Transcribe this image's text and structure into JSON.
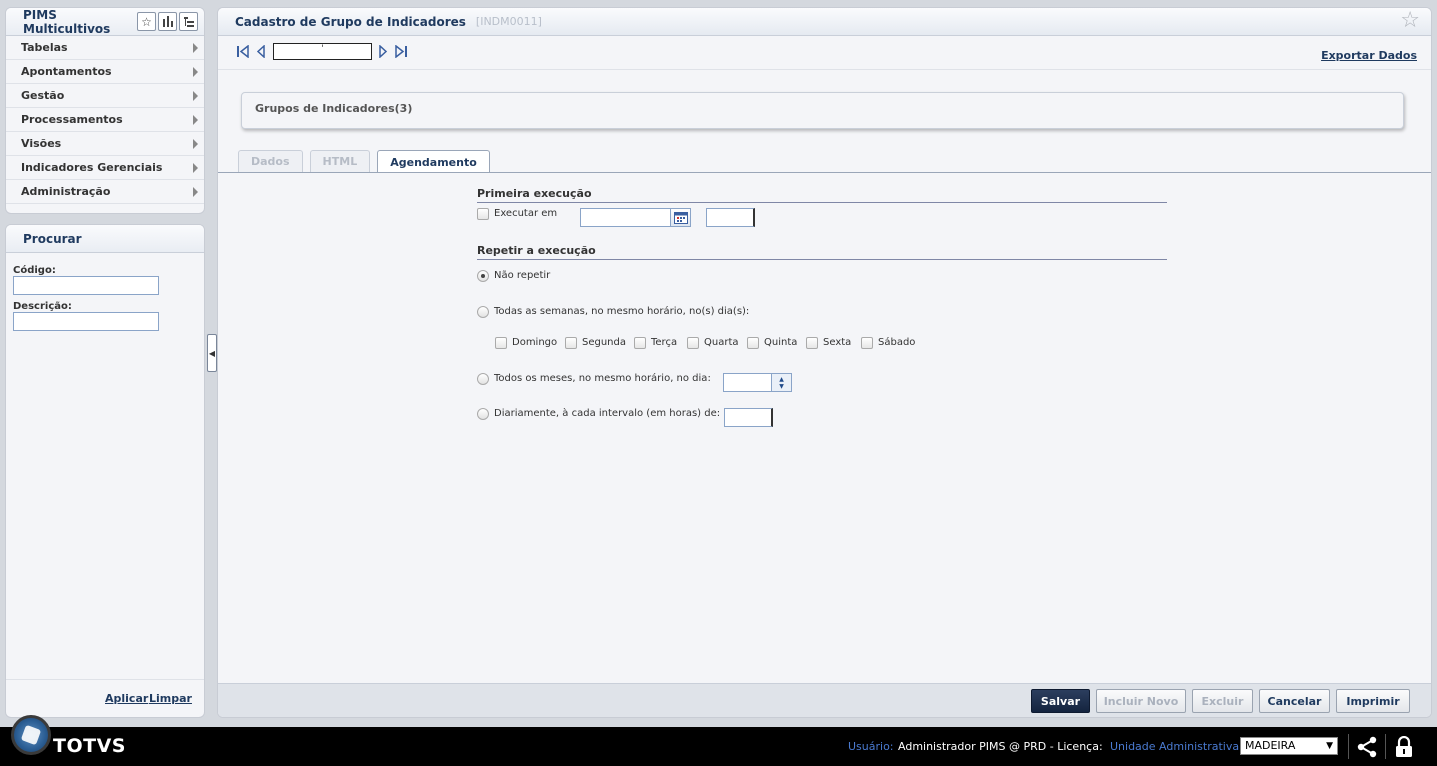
{
  "sidebar": {
    "title": "PIMS Multicultivos",
    "items": [
      {
        "label": "Tabelas"
      },
      {
        "label": "Apontamentos"
      },
      {
        "label": "Gestão"
      },
      {
        "label": "Processamentos"
      },
      {
        "label": "Visões"
      },
      {
        "label": "Indicadores Gerenciais"
      },
      {
        "label": "Administração"
      }
    ]
  },
  "search": {
    "title": "Procurar",
    "codigo_label": "Código:",
    "codigo_value": "",
    "descricao_label": "Descrição:",
    "descricao_value": "",
    "apply_label": "Aplicar",
    "clear_label": "Limpar"
  },
  "main": {
    "title": "Cadastro de Grupo de Indicadores",
    "code": "[INDM0011]",
    "record_field": "'",
    "export_label": "Exportar Dados",
    "group_title": "Grupos de Indicadores(3)",
    "tabs": [
      {
        "label": "Dados"
      },
      {
        "label": "HTML"
      },
      {
        "label": "Agendamento"
      }
    ]
  },
  "schedule": {
    "first_exec_title": "Primeira execução",
    "execute_at_label": "Executar em",
    "repeat_title": "Repetir a execução",
    "no_repeat_label": "Não repetir",
    "weekly_label": "Todas as semanas, no mesmo horário, no(s) dia(s):",
    "days": [
      "Domingo",
      "Segunda",
      "Terça",
      "Quarta",
      "Quinta",
      "Sexta",
      "Sábado"
    ],
    "monthly_label": "Todos os meses, no mesmo horário, no dia:",
    "daily_label": "Diariamente, à cada intervalo (em horas) de:"
  },
  "actions": {
    "save": "Salvar",
    "new": "Incluir Novo",
    "delete": "Excluir",
    "cancel": "Cancelar",
    "print": "Imprimir"
  },
  "status": {
    "brand": "TOTVS",
    "user_label": "Usuário:",
    "user_value": "Administrador PIMS @ PRD - Licença:",
    "unit_label": "Unidade Administrativa:",
    "unit_value": "MADEIRA"
  }
}
